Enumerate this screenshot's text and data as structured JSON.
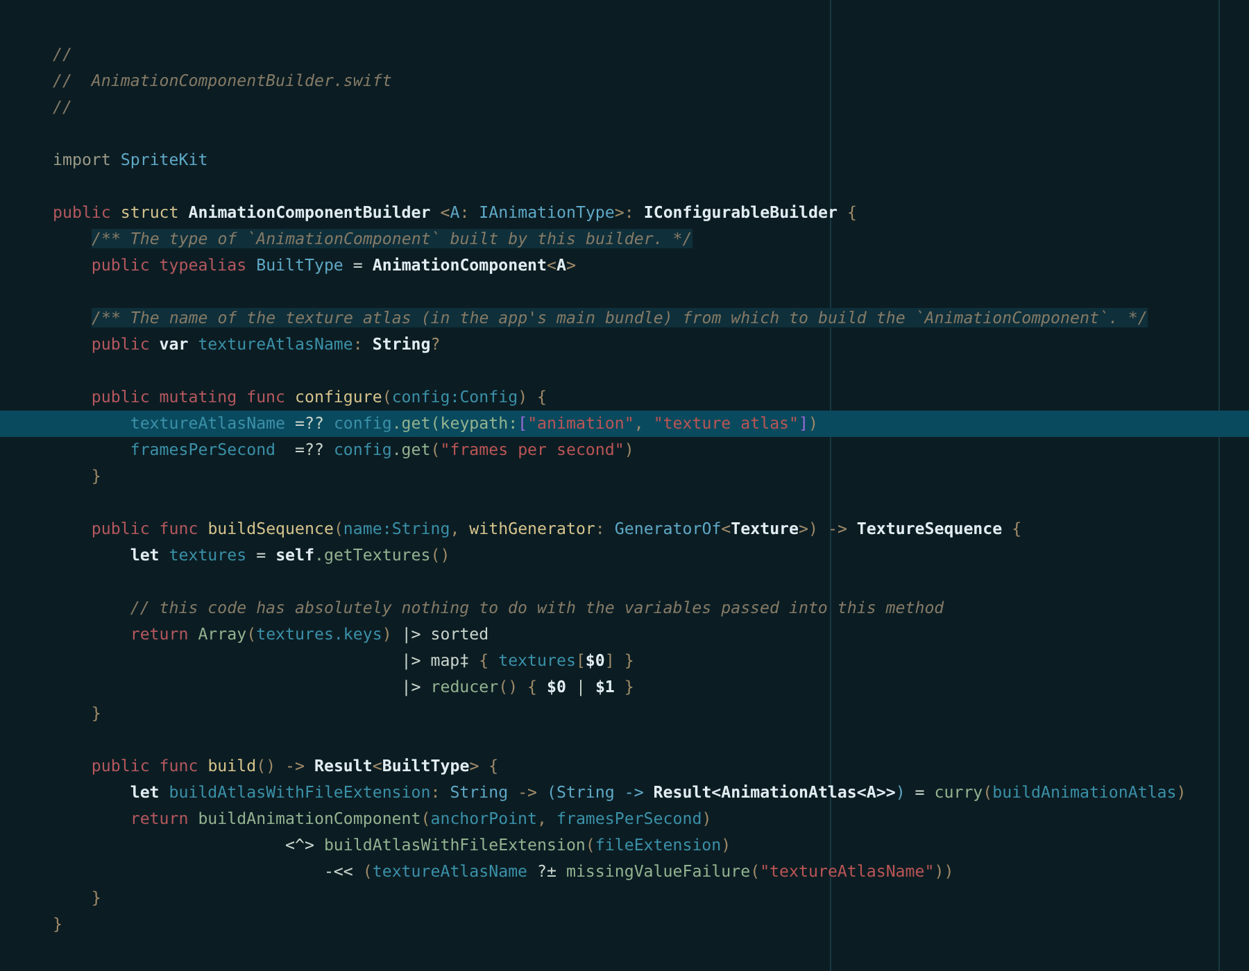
{
  "editor": {
    "blocks": [
      {
        "lines": [
          {
            "tokens": [
              {
                "text": "//",
                "kind": "comment"
              }
            ]
          },
          {
            "tokens": [
              {
                "text": "//  AnimationComponentBuilder.swift",
                "kind": "comment"
              }
            ]
          },
          {
            "tokens": [
              {
                "text": "//",
                "kind": "comment"
              }
            ]
          }
        ]
      },
      {
        "lines": [
          {
            "tokens": [
              {
                "text": "import ",
                "kind": "decl_dim"
              },
              {
                "text": "SpriteKit",
                "kind": "type_light"
              }
            ]
          }
        ]
      },
      {
        "lines": [
          {
            "tokens": [
              {
                "text": "public ",
                "kind": "keyword"
              },
              {
                "text": "struct ",
                "kind": "decl"
              },
              {
                "text": "AnimationComponentBuilder ",
                "kind": "type"
              },
              {
                "text": "<",
                "kind": "punct"
              },
              {
                "text": "A",
                "kind": "type_light"
              },
              {
                "text": ": ",
                "kind": "punct"
              },
              {
                "text": "IAnimationType",
                "kind": "type_light"
              },
              {
                "text": ">: ",
                "kind": "punct"
              },
              {
                "text": "IConfigurableBuilder ",
                "kind": "type"
              },
              {
                "text": "{",
                "kind": "punct"
              }
            ]
          },
          {
            "tokens": [
              {
                "text": "/** The type of `AnimationComponent` built by this builder. */",
                "kind": "doc"
              }
            ]
          },
          {
            "tokens": [
              {
                "text": "    public ",
                "kind": "keyword"
              },
              {
                "text": "typealias ",
                "kind": "keyword"
              },
              {
                "text": "BuiltType",
                "kind": "type_light"
              },
              {
                "text": " = ",
                "kind": "op"
              },
              {
                "text": "AnimationComponent",
                "kind": "type"
              },
              {
                "text": "<",
                "kind": "punct"
              },
              {
                "text": "A",
                "kind": "type"
              },
              {
                "text": ">",
                "kind": "punct"
              }
            ]
          }
        ]
      },
      {
        "lines": [
          {
            "tokens": [
              {
                "text": "/** The name of the texture atlas (in the app's main bundle) from which to build the `AnimationComponent`. */",
                "kind": "doc"
              }
            ]
          },
          {
            "tokens": [
              {
                "text": "    public ",
                "kind": "keyword"
              },
              {
                "text": "var ",
                "kind": "type"
              },
              {
                "text": "textureAtlasName",
                "kind": "var"
              },
              {
                "text": ": ",
                "kind": "punct"
              },
              {
                "text": "String",
                "kind": "type"
              },
              {
                "text": "?",
                "kind": "punct"
              }
            ]
          }
        ]
      },
      {
        "lines": [
          {
            "tokens": [
              {
                "text": "    public mutating func ",
                "kind": "keyword"
              },
              {
                "text": "configure",
                "kind": "func"
              },
              {
                "text": "(",
                "kind": "punct"
              },
              {
                "text": "config:Config",
                "kind": "var"
              },
              {
                "text": ") {",
                "kind": "punct"
              }
            ]
          },
          {
            "selected": true,
            "tokens": [
              {
                "text": "        textureAtlasName",
                "kind": "var"
              },
              {
                "text": " =?? ",
                "kind": "op"
              },
              {
                "text": "config",
                "kind": "var"
              },
              {
                "text": ".get(keypath:",
                "kind": "call"
              },
              {
                "text": "[",
                "kind": "bracket"
              },
              {
                "text": "\"animation\"",
                "kind": "string"
              },
              {
                "text": ", ",
                "kind": "punct"
              },
              {
                "text": "\"texture atlas\"",
                "kind": "string"
              },
              {
                "text": "]",
                "kind": "bracket"
              },
              {
                "text": ")",
                "kind": "punct"
              }
            ]
          },
          {
            "selected": false,
            "tokens": [
              {
                "text": "        framesPerSecond",
                "kind": "var"
              },
              {
                "text": "  =?? ",
                "kind": "op"
              },
              {
                "text": "config",
                "kind": "var"
              },
              {
                "text": ".get",
                "kind": "call"
              },
              {
                "text": "(",
                "kind": "punct"
              },
              {
                "text": "\"frames per second\"",
                "kind": "string"
              },
              {
                "text": ")",
                "kind": "punct"
              }
            ]
          },
          {
            "tokens": [
              {
                "text": "    }",
                "kind": "punct"
              }
            ]
          }
        ]
      },
      {
        "lines": [
          {
            "tokens": [
              {
                "text": "    public func ",
                "kind": "keyword"
              },
              {
                "text": "buildSequence",
                "kind": "func"
              },
              {
                "text": "(",
                "kind": "punct"
              },
              {
                "text": "name:String",
                "kind": "var"
              },
              {
                "text": ", ",
                "kind": "punct"
              },
              {
                "text": "withGenerator",
                "kind": "func"
              },
              {
                "text": ": ",
                "kind": "punct"
              },
              {
                "text": "GeneratorOf",
                "kind": "type_light"
              },
              {
                "text": "<",
                "kind": "punct"
              },
              {
                "text": "Texture",
                "kind": "type"
              },
              {
                "text": ">) -> ",
                "kind": "punct"
              },
              {
                "text": "TextureSequence",
                "kind": "type"
              },
              {
                "text": " {",
                "kind": "punct"
              }
            ]
          },
          {
            "tokens": [
              {
                "text": "        let ",
                "kind": "type"
              },
              {
                "text": "textures",
                "kind": "var"
              },
              {
                "text": " = ",
                "kind": "op"
              },
              {
                "text": "self",
                "kind": "type"
              },
              {
                "text": ".getTextures",
                "kind": "call"
              },
              {
                "text": "()",
                "kind": "punct"
              }
            ]
          }
        ]
      },
      {
        "lines": [
          {
            "tokens": [
              {
                "text": "        // this code has absolutely nothing to do with the variables passed into this method",
                "kind": "comment"
              }
            ]
          },
          {
            "tokens": [
              {
                "text": "        return ",
                "kind": "keyword"
              },
              {
                "text": "Array",
                "kind": "call"
              },
              {
                "text": "(",
                "kind": "punct"
              },
              {
                "text": "textures.keys",
                "kind": "var"
              },
              {
                "text": ") ",
                "kind": "punct"
              },
              {
                "text": "|> sorted",
                "kind": "op"
              }
            ]
          },
          {
            "tokens": [
              {
                "text": "                                    |> map‡ ",
                "kind": "op"
              },
              {
                "text": "{ ",
                "kind": "punct"
              },
              {
                "text": "textures",
                "kind": "var"
              },
              {
                "text": "[",
                "kind": "punct"
              },
              {
                "text": "$0",
                "kind": "type"
              },
              {
                "text": "] }",
                "kind": "punct"
              }
            ]
          },
          {
            "tokens": [
              {
                "text": "                                    |> ",
                "kind": "op"
              },
              {
                "text": "reducer",
                "kind": "call"
              },
              {
                "text": "() { ",
                "kind": "punct"
              },
              {
                "text": "$0",
                "kind": "type"
              },
              {
                "text": " | ",
                "kind": "op"
              },
              {
                "text": "$1",
                "kind": "type"
              },
              {
                "text": " }",
                "kind": "punct"
              }
            ]
          },
          {
            "tokens": [
              {
                "text": "    }",
                "kind": "punct"
              }
            ]
          }
        ]
      },
      {
        "lines": [
          {
            "tokens": [
              {
                "text": "    public func ",
                "kind": "keyword"
              },
              {
                "text": "build",
                "kind": "func"
              },
              {
                "text": "() -> ",
                "kind": "punct"
              },
              {
                "text": "Result",
                "kind": "type"
              },
              {
                "text": "<",
                "kind": "punct"
              },
              {
                "text": "BuiltType",
                "kind": "type"
              },
              {
                "text": "> {",
                "kind": "punct"
              }
            ]
          },
          {
            "tokens": [
              {
                "text": "        let ",
                "kind": "type"
              },
              {
                "text": "buildAtlasWithFileExtension",
                "kind": "var"
              },
              {
                "text": ": ",
                "kind": "punct"
              },
              {
                "text": "String",
                "kind": "type_light"
              },
              {
                "text": " -> ",
                "kind": "punct"
              },
              {
                "text": "(String -> ",
                "kind": "type_light"
              },
              {
                "text": "Result<AnimationAtlas<A>>",
                "kind": "type"
              },
              {
                "text": ")",
                "kind": "type_light"
              },
              {
                "text": " = ",
                "kind": "op"
              },
              {
                "text": "curry",
                "kind": "call"
              },
              {
                "text": "(",
                "kind": "punct"
              },
              {
                "text": "buildAnimationAtlas",
                "kind": "var"
              },
              {
                "text": ")",
                "kind": "punct"
              }
            ]
          },
          {
            "tokens": [
              {
                "text": "        return ",
                "kind": "keyword"
              },
              {
                "text": "buildAnimationComponent",
                "kind": "call"
              },
              {
                "text": "(",
                "kind": "punct"
              },
              {
                "text": "anchorPoint",
                "kind": "var"
              },
              {
                "text": ", ",
                "kind": "punct"
              },
              {
                "text": "framesPerSecond",
                "kind": "var"
              },
              {
                "text": ")",
                "kind": "punct"
              }
            ]
          },
          {
            "tokens": [
              {
                "text": "                        <^> ",
                "kind": "op"
              },
              {
                "text": "buildAtlasWithFileExtension",
                "kind": "call"
              },
              {
                "text": "(",
                "kind": "punct"
              },
              {
                "text": "fileExtension",
                "kind": "var"
              },
              {
                "text": ")",
                "kind": "punct"
              }
            ]
          },
          {
            "tokens": [
              {
                "text": "                            -<< ",
                "kind": "op"
              },
              {
                "text": "(",
                "kind": "punct"
              },
              {
                "text": "textureAtlasName",
                "kind": "var"
              },
              {
                "text": " ?± ",
                "kind": "op"
              },
              {
                "text": "missingValueFailure",
                "kind": "call"
              },
              {
                "text": "(",
                "kind": "punct"
              },
              {
                "text": "\"textureAtlasName\"",
                "kind": "string"
              },
              {
                "text": "))",
                "kind": "punct"
              }
            ]
          },
          {
            "tokens": [
              {
                "text": "    }",
                "kind": "punct"
              }
            ]
          },
          {
            "tokens": [
              {
                "text": "}",
                "kind": "punct"
              }
            ]
          }
        ]
      }
    ]
  }
}
